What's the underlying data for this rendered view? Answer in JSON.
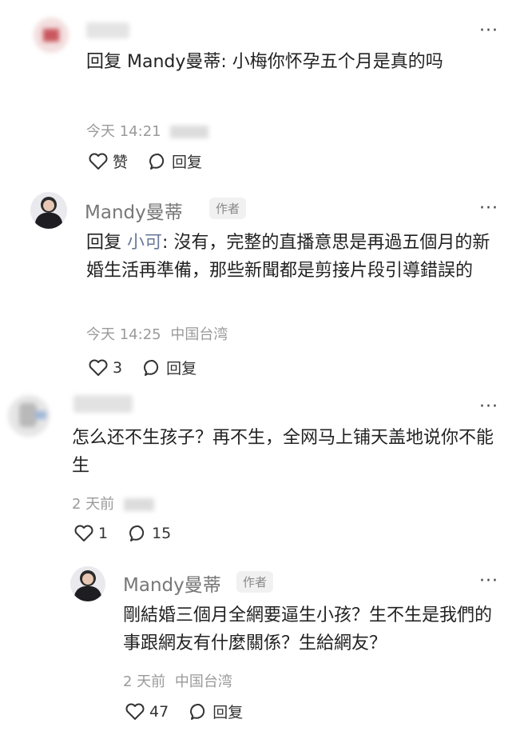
{
  "comments": [
    {
      "name": "",
      "text_prefix": "回复 Mandy曼蒂: ",
      "text": "小梅你怀孕五个月是真的吗",
      "time": "今天 14:21",
      "like_label": "赞",
      "reply_label": "回复",
      "more": "···"
    },
    {
      "name": "Mandy曼蒂",
      "badge": "作者",
      "text_prefix": "回复 ",
      "mention": "小可",
      "text": ": 沒有，完整的直播意思是再過五個月的新婚生活再準備，那些新聞都是剪接片段引導錯誤的",
      "time": "今天 14:25",
      "location": "中国台湾",
      "likes": "3",
      "reply_label": "回复",
      "more": "···"
    },
    {
      "name": "",
      "text": "怎么还不生孩子？再不生，全网马上铺天盖地说你不能生",
      "time": "2 天前",
      "likes": "1",
      "replies": "15",
      "more": "···"
    },
    {
      "name": "Mandy曼蒂",
      "badge": "作者",
      "text": "剛結婚三個月全網要逼生小孩？生不生是我們的事跟網友有什麼關係？生給網友？",
      "time": "2 天前",
      "location": "中国台湾",
      "likes": "47",
      "reply_label": "回复",
      "more": "···"
    }
  ],
  "colors": {
    "text": "#222222",
    "meta": "#9a9a9a",
    "mention": "#6b7a9a",
    "badge_bg": "#f1f1f1"
  }
}
